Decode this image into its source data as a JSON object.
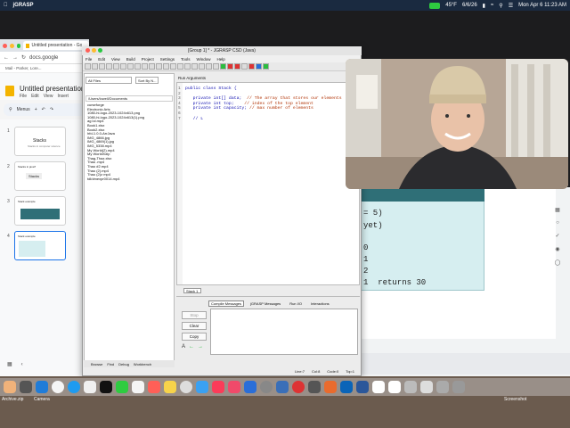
{
  "menubar": {
    "app": "jGRASP",
    "weather": "45°F",
    "date_short": "6/6/26",
    "datetime": "Mon Apr 6  11:23 AM"
  },
  "chrome": {
    "tab_title": "Untitled presentation - Go",
    "address": "docs.google",
    "bookmark": "Mail - Parker, Lore...",
    "pres_title": "Untitled presentation",
    "menu": [
      "File",
      "Edit",
      "View",
      "Insert"
    ],
    "menus_label": "Menus",
    "slides": [
      {
        "num": "1",
        "title": "Stacks",
        "sub": "Stacks in computer science"
      },
      {
        "num": "2",
        "title": "Stacks in java?",
        "sub": "Stacks"
      },
      {
        "num": "3",
        "title": "Stack example",
        "sub": ""
      },
      {
        "num": "4",
        "title": "Stack example",
        "sub": ""
      }
    ]
  },
  "slide_code": {
    "lines": [
      "= 5)",
      "yet)",
      "",
      "0",
      "1",
      "2",
      "1  returns 30"
    ]
  },
  "jgrasp": {
    "title": "[Group 1] * - JGRASP CSD (Java)",
    "menu": [
      "File",
      "Edit",
      "View",
      "Build",
      "Project",
      "Settings",
      "Tools",
      "Window",
      "Help"
    ],
    "files_select": "All Files",
    "sort_select": "Sort By N...",
    "path": "/Users/lowell/Documents",
    "files": [
      "curseforge",
      "Electronic Arts",
      "1080-hi-logo-2023-1024x613.png",
      "1080-hi-logo-2023-1024x613(1).png",
      "ag lol.mp4",
      "Book1.xlsx",
      "Book2.xlsx",
      "hfd-1.0.0-ArrJava",
      "IMG_4866.jpg",
      "IMG_4869(1).jpg",
      "IMG_5338.mp4",
      "My World(2).mp4",
      "My WorldXlzip",
      "Thag-Thaz.xlsx",
      "Thao .mp4",
      "Thao #2.mp4",
      "Thao (2).mp4",
      "Thao (2)z mp4",
      "tdl/dmexpr0014.mp4"
    ],
    "browse_tabs": [
      "Browse",
      "Find",
      "Debug",
      "Workbench"
    ],
    "run_args": "Run Arguments",
    "code_lines": [
      {
        "n": "1",
        "t": "public class Stack {",
        "cm": ""
      },
      {
        "n": "2",
        "t": "",
        "cm": ""
      },
      {
        "n": "3",
        "t": "   private int[] data;",
        "cm": "  // The array that stores our elements"
      },
      {
        "n": "4",
        "t": "   private int top;",
        "cm": "    // index of the top element"
      },
      {
        "n": "5",
        "t": "   private int capacity;",
        "cm": " // max number of elements"
      },
      {
        "n": "6",
        "t": "",
        "cm": ""
      },
      {
        "n": "7",
        "t": "   // L",
        "cm": ""
      }
    ],
    "edit_tab": "Stack 1",
    "msg_tabs": [
      "Compile Messages",
      "jGRASP Messages",
      "Run I/O",
      "Interactions"
    ],
    "buttons": [
      "Stop",
      "Clear",
      "Copy"
    ],
    "status": [
      "Line:7",
      "Col:8",
      "Code:0",
      "Top:1"
    ]
  },
  "dock": {
    "labels": [
      "Archive.zip",
      "Camera",
      " ",
      "Screenshot"
    ]
  }
}
